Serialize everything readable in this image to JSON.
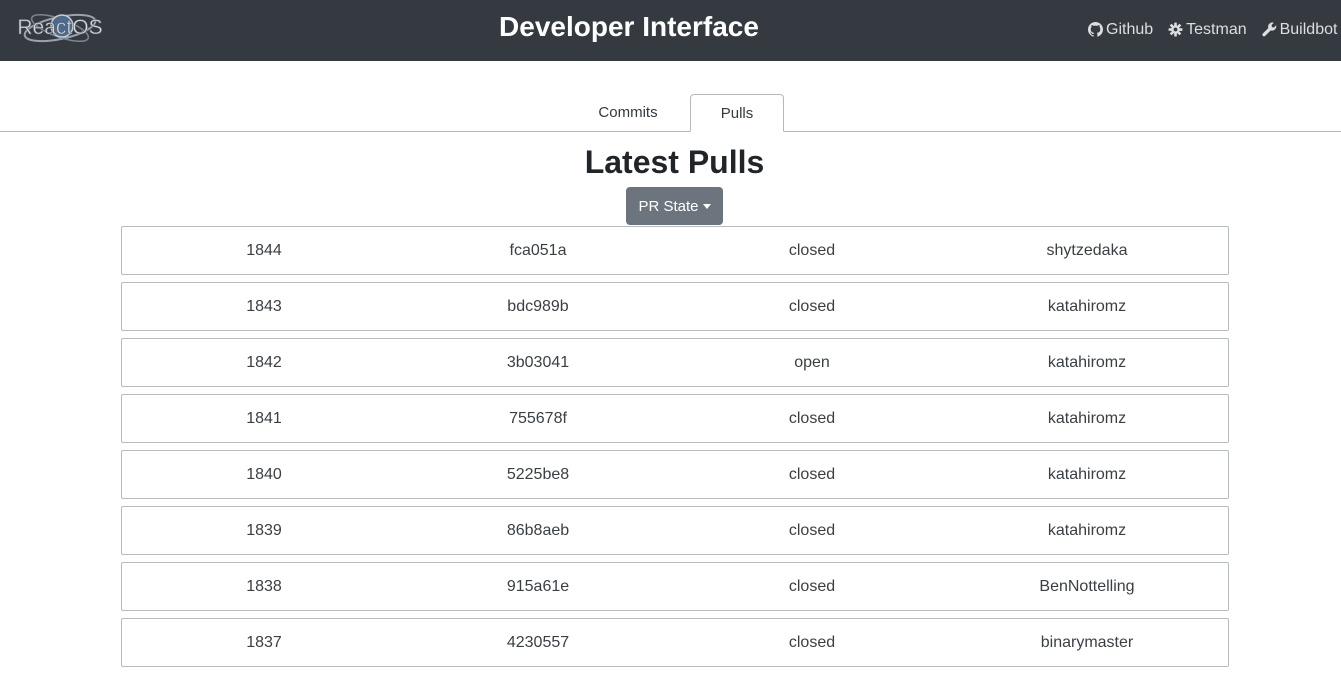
{
  "navbar": {
    "logo_text": "ReactOS",
    "title": "Developer Interface",
    "links": [
      {
        "label": "Github",
        "icon": "github-icon"
      },
      {
        "label": "Testman",
        "icon": "gear-icon"
      },
      {
        "label": "Buildbot",
        "icon": "wrench-icon"
      }
    ]
  },
  "tabs": [
    {
      "label": "Commits",
      "active": false
    },
    {
      "label": "Pulls",
      "active": true
    }
  ],
  "main": {
    "title": "Latest Pulls",
    "state_dropdown_label": "PR State"
  },
  "pulls": [
    {
      "number": "1844",
      "sha": "fca051a",
      "state": "closed",
      "user": "shytzedaka"
    },
    {
      "number": "1843",
      "sha": "bdc989b",
      "state": "closed",
      "user": "katahiromz"
    },
    {
      "number": "1842",
      "sha": "3b03041",
      "state": "open",
      "user": "katahiromz"
    },
    {
      "number": "1841",
      "sha": "755678f",
      "state": "closed",
      "user": "katahiromz"
    },
    {
      "number": "1840",
      "sha": "5225be8",
      "state": "closed",
      "user": "katahiromz"
    },
    {
      "number": "1839",
      "sha": "86b8aeb",
      "state": "closed",
      "user": "katahiromz"
    },
    {
      "number": "1838",
      "sha": "915a61e",
      "state": "closed",
      "user": "BenNottelling"
    },
    {
      "number": "1837",
      "sha": "4230557",
      "state": "closed",
      "user": "binarymaster"
    }
  ],
  "colors": {
    "navbar_bg": "#343a40",
    "button_bg": "#6c757d"
  }
}
